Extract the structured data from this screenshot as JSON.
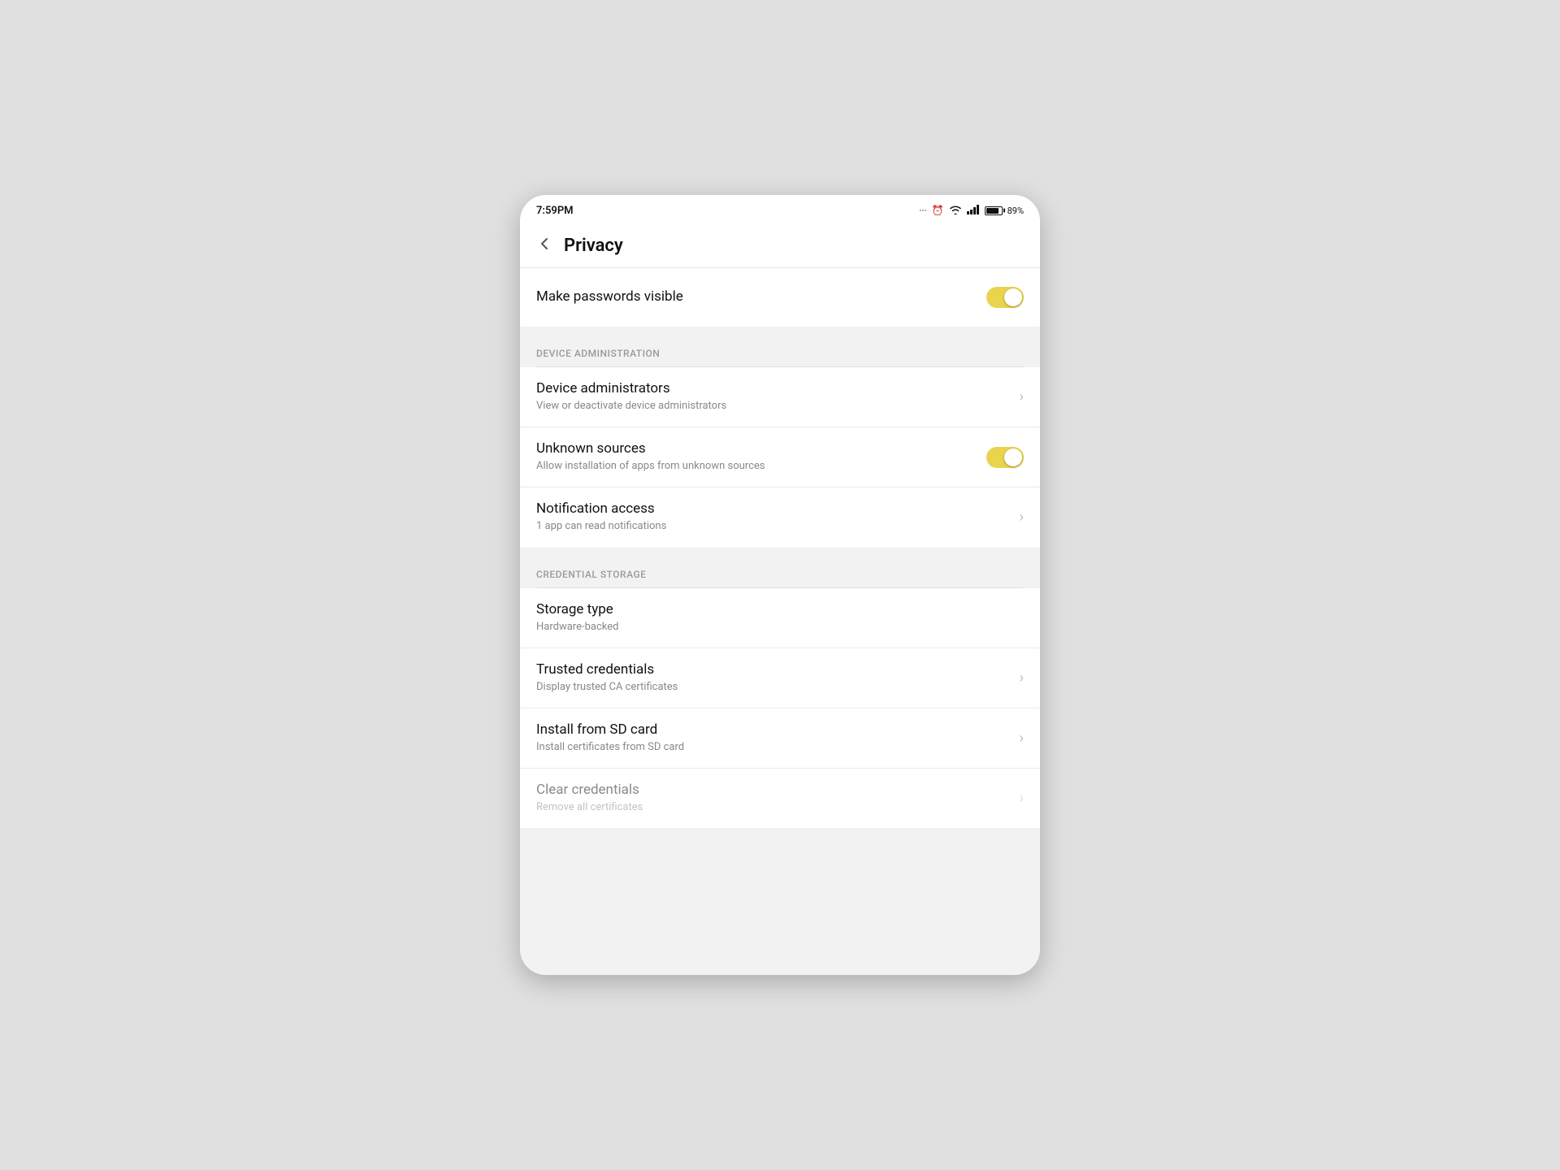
{
  "statusBar": {
    "time": "7:59PM",
    "battery_percent": "89%",
    "icons": {
      "dots": "···",
      "alarm": "⏰",
      "wifi": "WiFi",
      "signal": "Signal"
    }
  },
  "header": {
    "back_label": "‹",
    "title": "Privacy"
  },
  "sections": {
    "privacy": {
      "items": [
        {
          "id": "make-passwords-visible",
          "title": "Make passwords visible",
          "subtitle": "",
          "type": "toggle",
          "toggle_on": true
        }
      ]
    },
    "device_administration": {
      "label": "DEVICE ADMINISTRATION",
      "items": [
        {
          "id": "device-administrators",
          "title": "Device administrators",
          "subtitle": "View or deactivate device administrators",
          "type": "navigate"
        },
        {
          "id": "unknown-sources",
          "title": "Unknown sources",
          "subtitle": "Allow installation of apps from unknown sources",
          "type": "toggle",
          "toggle_on": true
        },
        {
          "id": "notification-access",
          "title": "Notification access",
          "subtitle": "1 app can read notifications",
          "type": "navigate"
        }
      ]
    },
    "credential_storage": {
      "label": "CREDENTIAL STORAGE",
      "items": [
        {
          "id": "storage-type",
          "title": "Storage type",
          "subtitle": "Hardware-backed",
          "type": "static"
        },
        {
          "id": "trusted-credentials",
          "title": "Trusted credentials",
          "subtitle": "Display trusted CA certificates",
          "type": "navigate"
        },
        {
          "id": "install-from-sd-card",
          "title": "Install from SD card",
          "subtitle": "Install certificates from SD card",
          "type": "navigate"
        },
        {
          "id": "clear-credentials",
          "title": "Clear credentials",
          "subtitle": "Remove all certificates",
          "type": "navigate",
          "disabled": true
        }
      ]
    }
  }
}
